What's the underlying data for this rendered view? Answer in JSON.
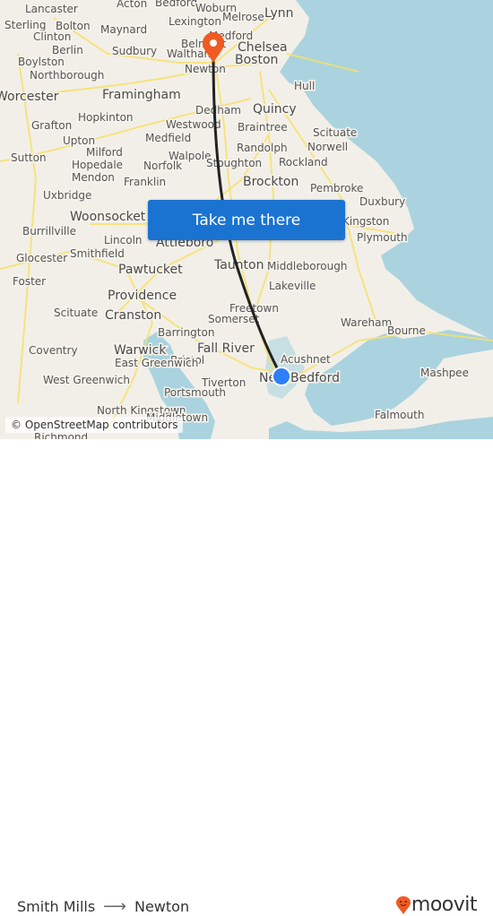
{
  "map": {
    "attribution": "© OpenStreetMap contributors",
    "labels": [
      "Lancaster",
      "Acton",
      "Bedford",
      "Woburn",
      "Lynn",
      "Sterling",
      "Bolton",
      "Maynard",
      "Lexington",
      "Melrose",
      "Medford",
      "Clinton",
      "Berlin",
      "Sudbury",
      "Belmont",
      "Chelsea",
      "Waltham",
      "Boston",
      "Boylston",
      "Newton",
      "Northborough",
      "Hull",
      "Worcester",
      "Framingham",
      "Dedham",
      "Quincy",
      "Hopkinton",
      "Grafton",
      "Westwood",
      "Braintree",
      "Scituate",
      "Upton",
      "Medfield",
      "Randolph",
      "Norwell",
      "Milford",
      "Walpole",
      "Sutton",
      "Hopedale",
      "Norfolk",
      "Stoughton",
      "Rockland",
      "Mendon",
      "Franklin",
      "Brockton",
      "Pembroke",
      "Uxbridge",
      "Duxbury",
      "Woonsocket",
      "Kingston",
      "Burrillville",
      "Lincoln",
      "Attleboro",
      "Plymouth",
      "Smithfield",
      "Glocester",
      "Pawtucket",
      "Taunton",
      "Middleborough",
      "Foster",
      "Lakeville",
      "Providence",
      "Scituate",
      "Cranston",
      "Freetown",
      "Somerset",
      "Wareham",
      "Barrington",
      "Bourne",
      "Fall River",
      "Acushnet",
      "Warwick",
      "Coventry",
      "Bristol",
      "East Greenwich",
      "Mashpee",
      "West Greenwich",
      "Tiverton",
      "New Bedford",
      "Portsmouth",
      "North Kingstown",
      "Middletown",
      "Falmouth",
      "Richmond"
    ],
    "accent_color": "#1a73d1",
    "origin_pin_color": "#2d7ff9",
    "destination_pin_color": "#f15a22"
  },
  "cta": {
    "label": "Take me there"
  },
  "footer": {
    "origin": "Smith Mills",
    "arrow": "⟶",
    "destination": "Newton",
    "logo_text": "moovit"
  }
}
